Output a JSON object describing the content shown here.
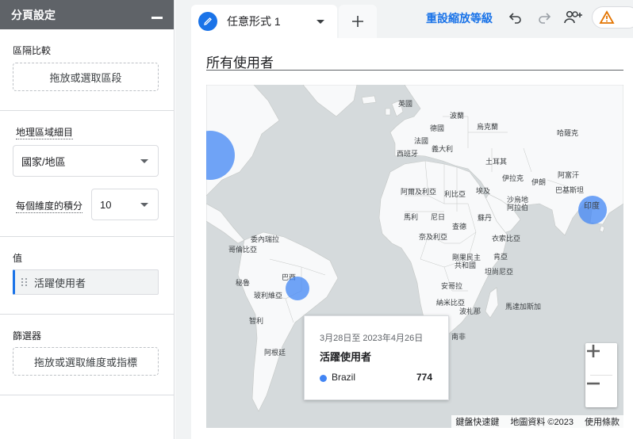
{
  "panel": {
    "title": "分頁設定",
    "segment_comparison": {
      "label": "區隔比較",
      "drop_text": "拖放或選取區段"
    },
    "geo": {
      "label": "地理區域細目",
      "dimension_value": "國家/地區",
      "points_label": "每個維度的積分",
      "points_value": "10"
    },
    "values": {
      "label": "值",
      "metric": "活躍使用者"
    },
    "filters": {
      "label": "篩選器",
      "drop_text": "拖放或選取維度或指標"
    }
  },
  "tabs": {
    "active_label": "任意形式 1",
    "add_icon": "plus-icon"
  },
  "toolbar": {
    "reset_zoom": "重設縮放等級",
    "icons": [
      "undo-icon",
      "redo-icon",
      "share-users-icon",
      "warning-icon"
    ]
  },
  "card": {
    "title": "所有使用者"
  },
  "map": {
    "countries": [
      {
        "name": "英國"
      },
      {
        "name": "波蘭"
      },
      {
        "name": "烏克蘭"
      },
      {
        "name": "德國"
      },
      {
        "name": "哈薩克"
      },
      {
        "name": "法國"
      },
      {
        "name": "義大利"
      },
      {
        "name": "西班牙"
      },
      {
        "name": "土耳其"
      },
      {
        "name": "伊拉克"
      },
      {
        "name": "伊朗"
      },
      {
        "name": "阿富汗"
      },
      {
        "name": "阿爾及利亞"
      },
      {
        "name": "利比亞"
      },
      {
        "name": "埃及"
      },
      {
        "name": "沙烏地"
      },
      {
        "name": "阿拉伯"
      },
      {
        "name": "巴基斯坦"
      },
      {
        "name": "馬利"
      },
      {
        "name": "尼日"
      },
      {
        "name": "蘇丹"
      },
      {
        "name": "查德"
      },
      {
        "name": "奈及利亞"
      },
      {
        "name": "衣索比亞"
      },
      {
        "name": "委內瑞拉"
      },
      {
        "name": "哥倫比亞"
      },
      {
        "name": "剛果民主"
      },
      {
        "name": "共和國"
      },
      {
        "name": "肯亞"
      },
      {
        "name": "坦尚尼亞"
      },
      {
        "name": "秘魯"
      },
      {
        "name": "巴西"
      },
      {
        "name": "玻利維亞"
      },
      {
        "name": "安哥拉"
      },
      {
        "name": "納米比亞"
      },
      {
        "name": "波札那"
      },
      {
        "name": "馬達加斯加"
      },
      {
        "name": "智利"
      },
      {
        "name": "南非"
      },
      {
        "name": "阿根廷"
      }
    ],
    "bubble_label": "印度",
    "tooltip": {
      "date_range": "3月28日至 2023年4月26日",
      "metric": "活躍使用者",
      "country": "Brazil",
      "value": "774"
    },
    "attribution": {
      "shortcuts": "鍵盤快速鍵",
      "map_data": "地圖資料 ©2023",
      "terms": "使用條款"
    },
    "accent_color": "#4285f4"
  }
}
